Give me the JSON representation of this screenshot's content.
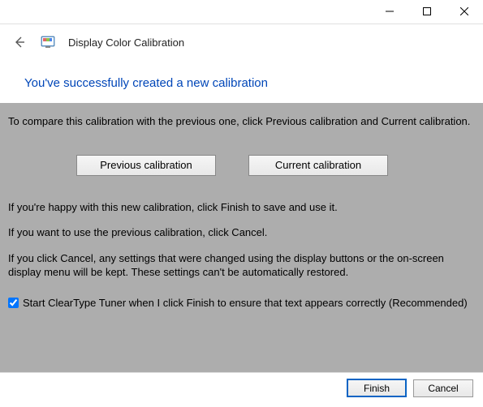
{
  "nav": {
    "title": "Display Color Calibration"
  },
  "heading": "You've successfully created a new calibration",
  "body": {
    "compare": "To compare this calibration with the previous one, click Previous calibration and Current calibration.",
    "prev_btn": "Previous calibration",
    "curr_btn": "Current calibration",
    "happy": "If you're happy with this new calibration, click Finish to save and use it.",
    "use_prev": "If you want to use the previous calibration, click Cancel.",
    "cancel_note": "If you click Cancel, any settings that were changed using the display buttons or the on-screen display menu will be kept. These settings can't be automatically restored.",
    "cleartype": "Start ClearType Tuner when I click Finish to ensure that text appears correctly (Recommended)"
  },
  "footer": {
    "finish": "Finish",
    "cancel": "Cancel"
  }
}
